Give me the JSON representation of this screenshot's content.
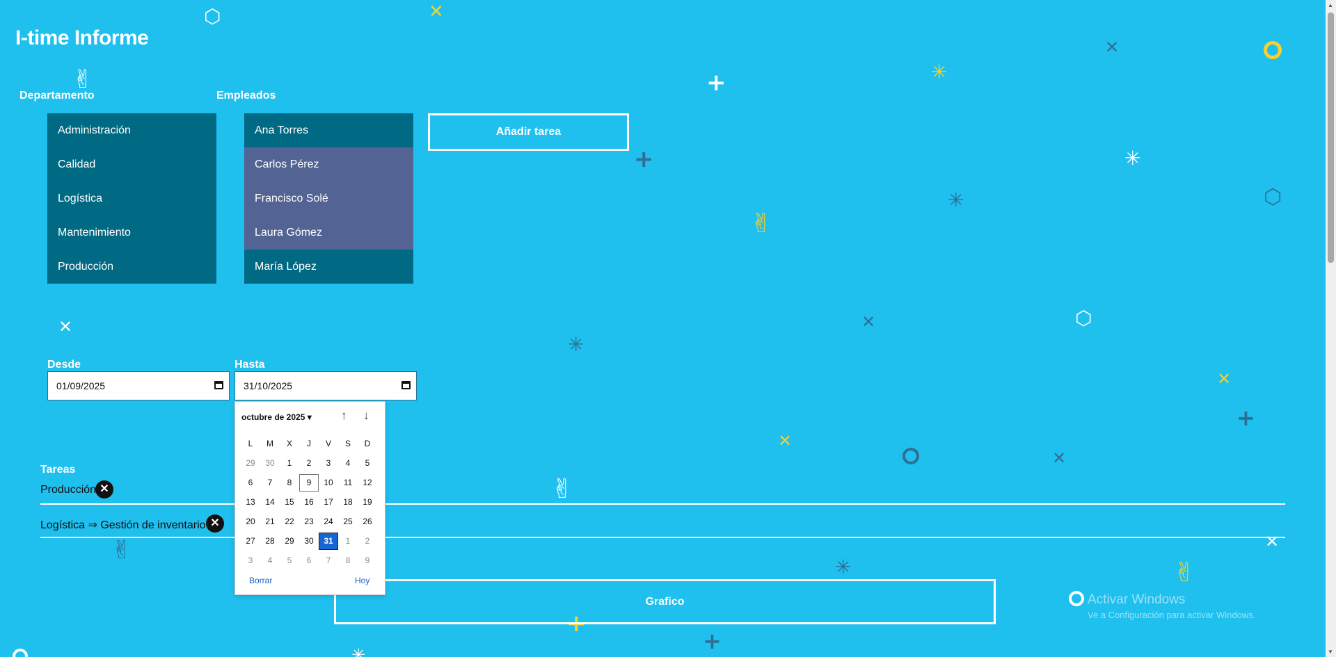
{
  "app": {
    "title": "I-time Informe"
  },
  "filters": {
    "department_label": "Departamento",
    "employees_label": "Empleados",
    "departments": [
      "Administración",
      "Calidad",
      "Logística",
      "Mantenimiento",
      "Producción"
    ],
    "employees": [
      {
        "name": "Ana Torres",
        "selected": false
      },
      {
        "name": "Carlos Pérez",
        "selected": true
      },
      {
        "name": "Francisco Solé",
        "selected": true
      },
      {
        "name": "Laura Gómez",
        "selected": true
      },
      {
        "name": "María López",
        "selected": false
      }
    ],
    "add_task_label": "Añadir tarea"
  },
  "dates": {
    "from_label": "Desde",
    "from_value": "01/09/2025",
    "to_label": "Hasta",
    "to_value": "31/10/2025"
  },
  "calendar": {
    "month_label": "octubre de 2025",
    "weekdays": [
      "L",
      "M",
      "X",
      "J",
      "V",
      "S",
      "D"
    ],
    "weeks": [
      [
        "29",
        "30",
        "1",
        "2",
        "3",
        "4",
        "5"
      ],
      [
        "6",
        "7",
        "8",
        "9",
        "10",
        "11",
        "12"
      ],
      [
        "13",
        "14",
        "15",
        "16",
        "17",
        "18",
        "19"
      ],
      [
        "20",
        "21",
        "22",
        "23",
        "24",
        "25",
        "26"
      ],
      [
        "27",
        "28",
        "29",
        "30",
        "31",
        "1",
        "2"
      ],
      [
        "3",
        "4",
        "5",
        "6",
        "7",
        "8",
        "9"
      ]
    ],
    "today": "9",
    "selected": "31",
    "clear_label": "Borrar",
    "today_label": "Hoy"
  },
  "tasks": {
    "label": "Tareas",
    "items": [
      "Producción",
      "Logística ⇒ Gestión de inventario"
    ]
  },
  "chart_button_label": "Grafico",
  "watermark": {
    "title": "Activar Windows",
    "subtitle": "Ve a Configuración para activar Windows."
  },
  "colors": {
    "background": "#1fbfee",
    "list_bg": "#006a85",
    "list_selected_bg": "#536393",
    "deco_yellow": "#f6d02f",
    "deco_dark": "#2f6f96"
  },
  "decorations": {
    "icons": [
      "box-icon",
      "x-icon",
      "plus-icon",
      "ring-icon",
      "spinner-icon",
      "peace-hand-icon"
    ]
  }
}
